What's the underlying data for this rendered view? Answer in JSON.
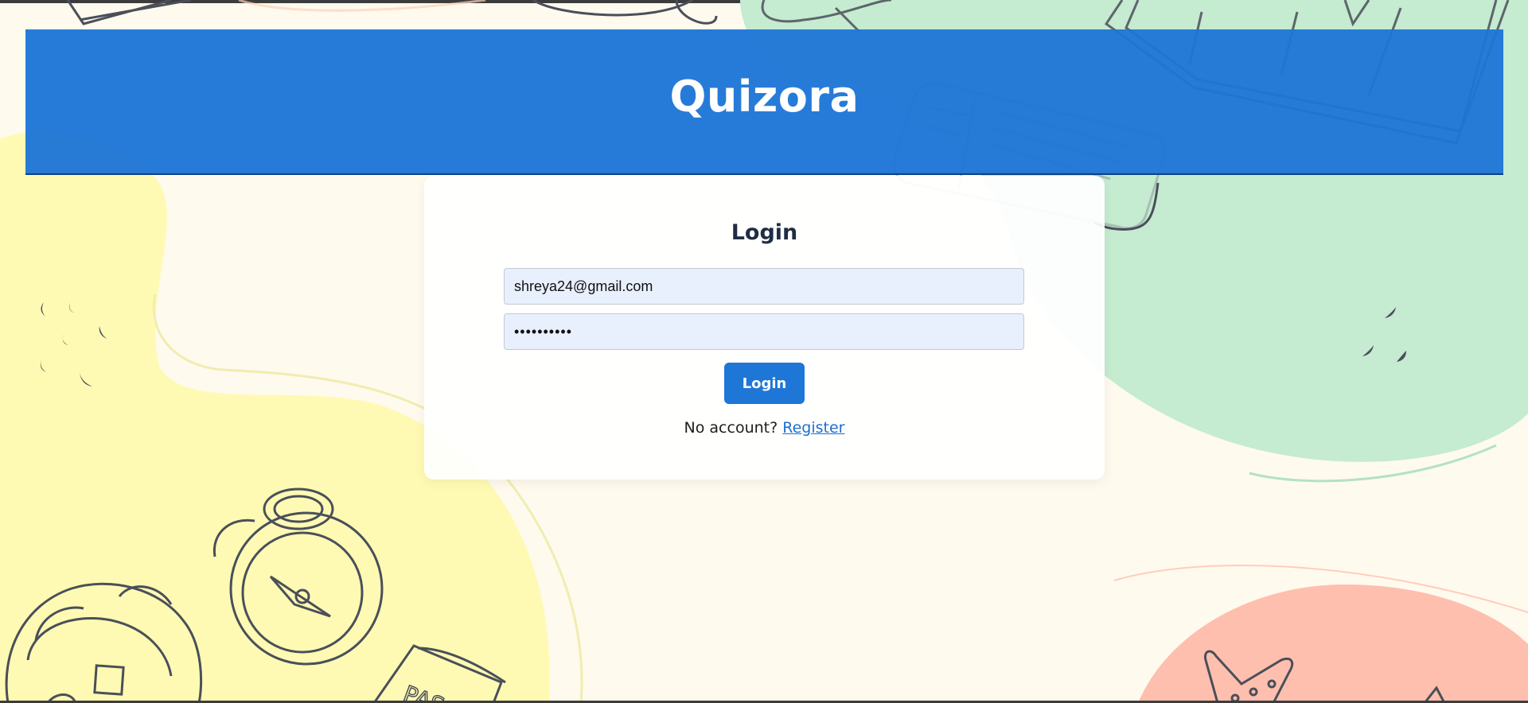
{
  "app": {
    "title": "Quizora"
  },
  "login": {
    "heading": "Login",
    "email_value": "shreya24@gmail.com",
    "password_value": "••••••••••",
    "submit_label": "Login",
    "no_account_text": "No account? ",
    "register_link_label": "Register"
  },
  "theme": {
    "header_color": "#1e76d6",
    "button_color": "#1e76d6",
    "link_color": "#1e6fd0",
    "bg_yellow": "#fffab3",
    "bg_green": "#c5ebd0",
    "bg_coral": "#ffbfae",
    "bg_cream": "#fffaee"
  },
  "decorations": [
    "compass-doodle",
    "backpack-doodle",
    "passport-doodle",
    "ticket-doodle",
    "starfish-doodle",
    "bird-doodle"
  ]
}
